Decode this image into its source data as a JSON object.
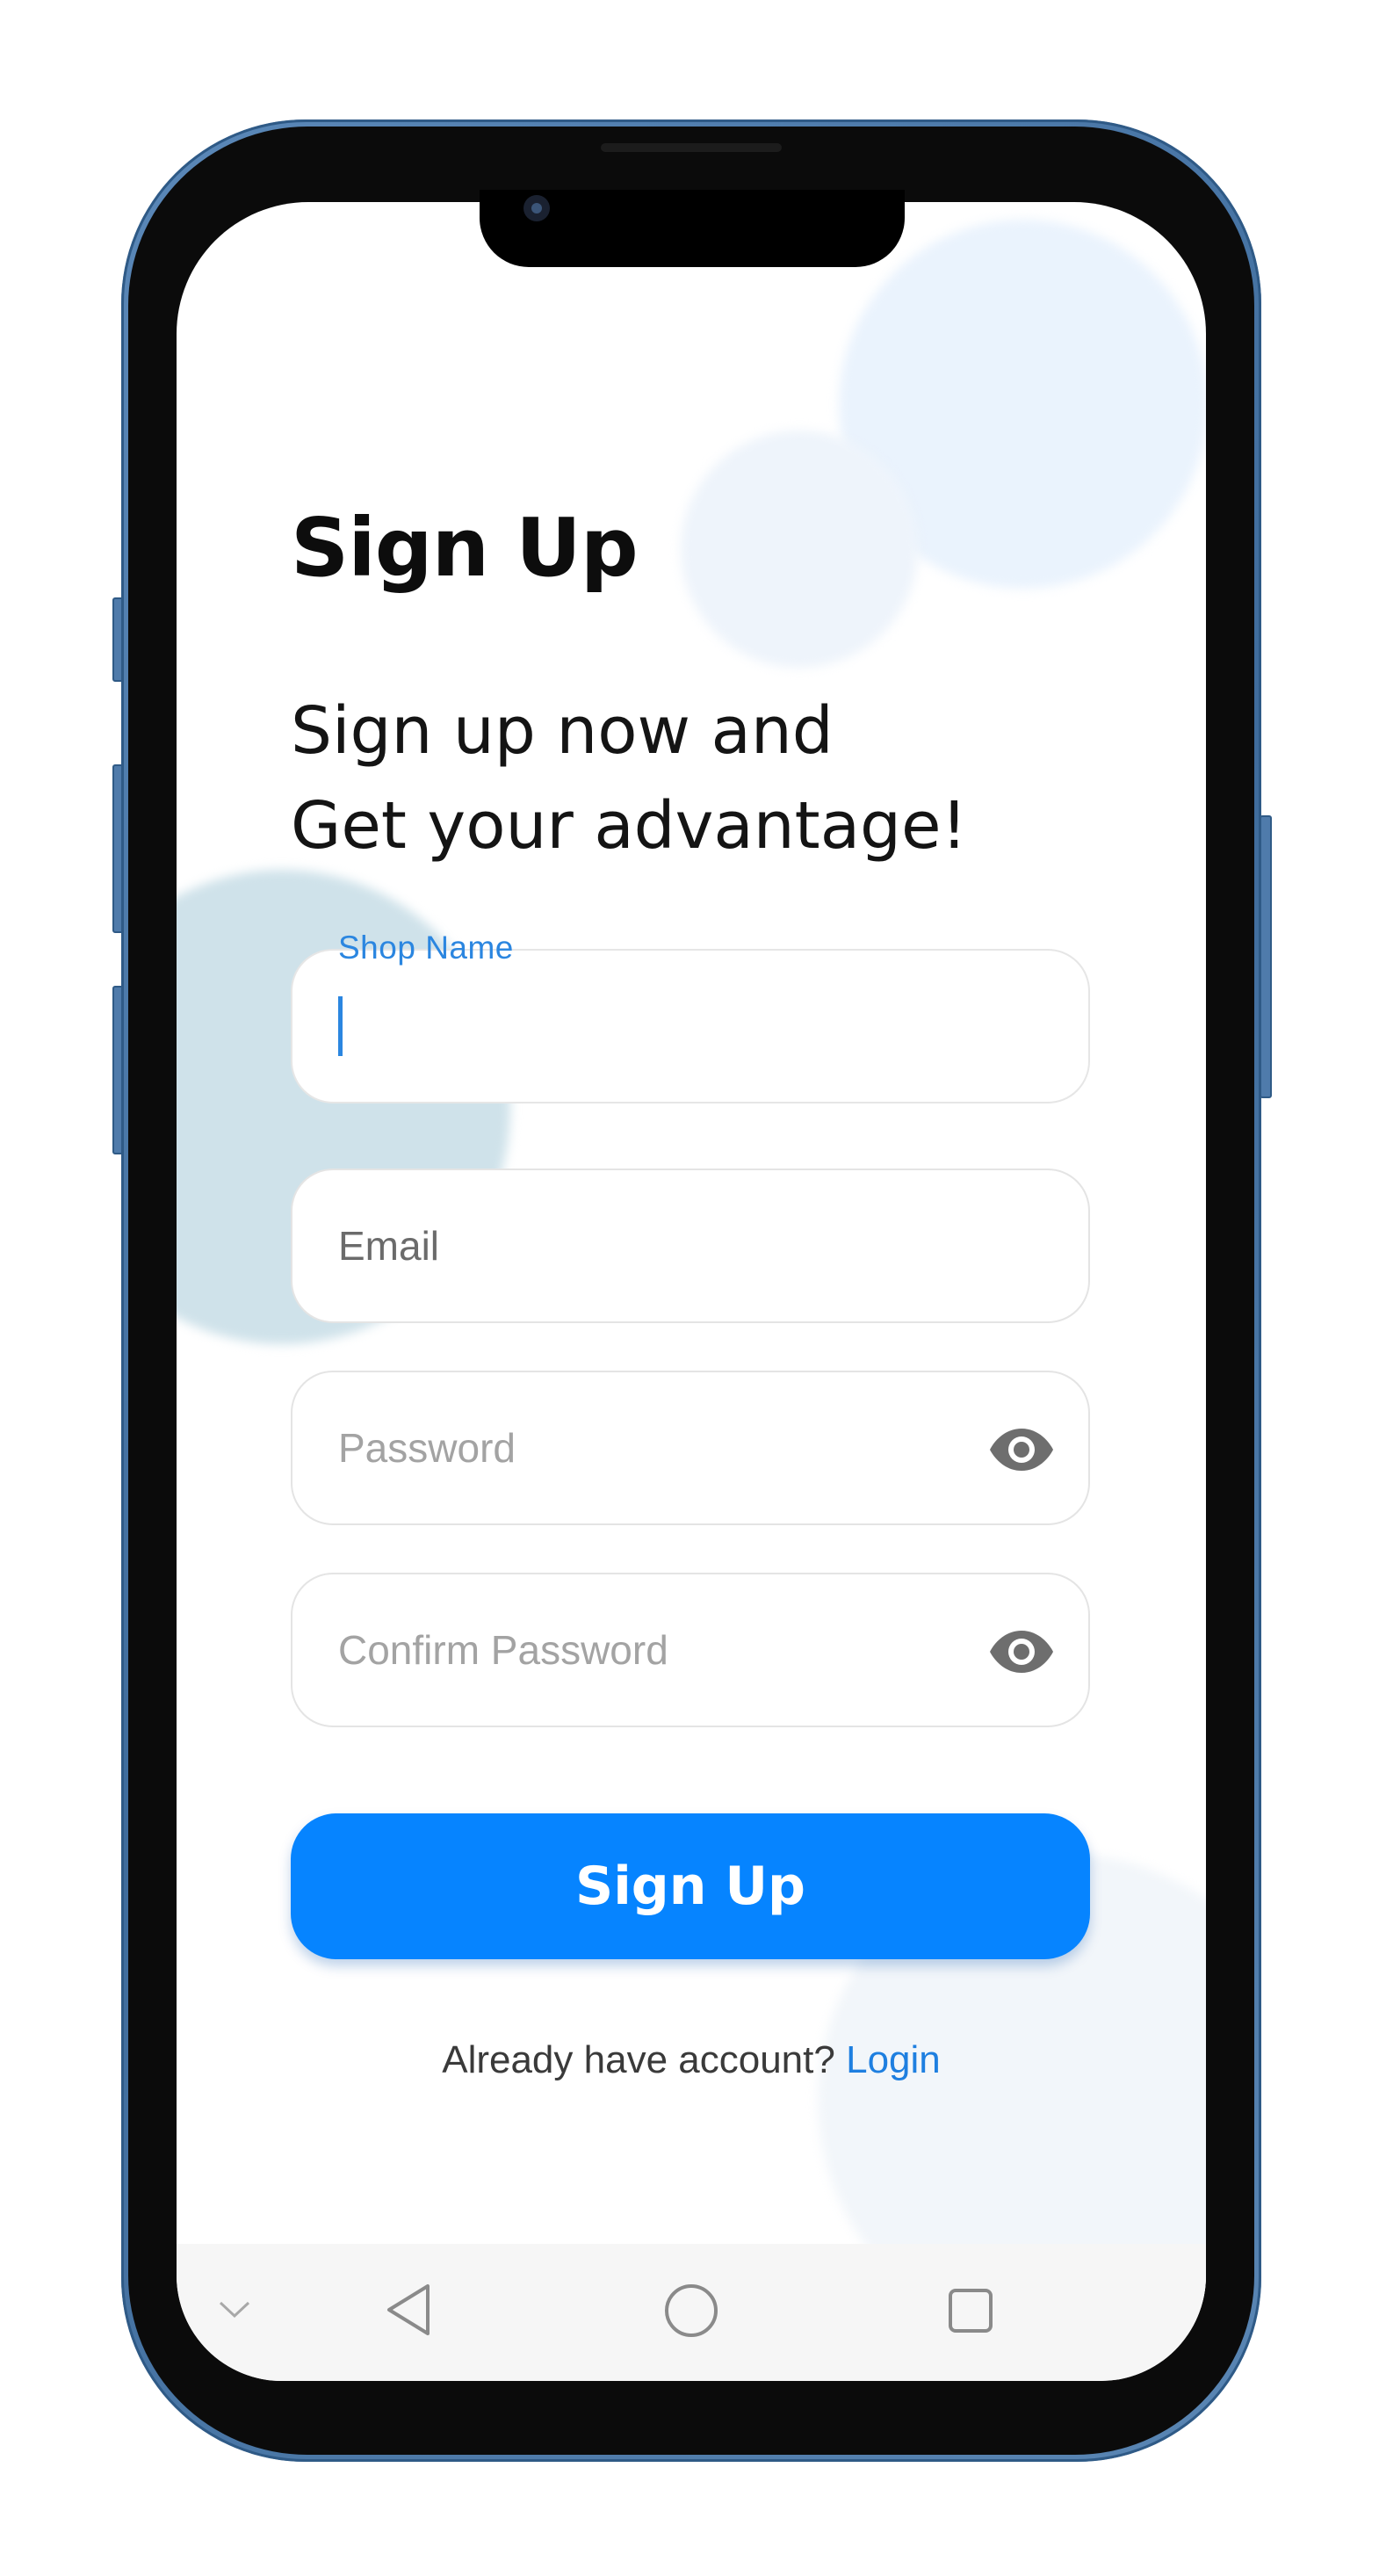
{
  "screen": {
    "title": "Sign Up",
    "subtitle_line1": "Sign up now and",
    "subtitle_line2": "Get your advantage!"
  },
  "form": {
    "shop_name": {
      "label": "Shop Name",
      "value": ""
    },
    "email": {
      "placeholder": "Email",
      "value": ""
    },
    "password": {
      "placeholder": "Password",
      "value": ""
    },
    "confirm_password": {
      "placeholder": "Confirm Password",
      "value": ""
    }
  },
  "actions": {
    "signup_label": "Sign Up",
    "have_account_text": "Already have account?",
    "login_label": "Login"
  },
  "icons": {
    "password_toggle": "eye-icon",
    "confirm_toggle": "eye-icon",
    "nav_collapse": "chevron-down-icon",
    "nav_back": "triangle-back-icon",
    "nav_home": "circle-home-icon",
    "nav_recents": "square-recents-icon"
  },
  "colors": {
    "primary": "#0684ff",
    "link": "#1e7fe0",
    "label_focus": "#2b86e0",
    "frame": "#4f7bab"
  }
}
